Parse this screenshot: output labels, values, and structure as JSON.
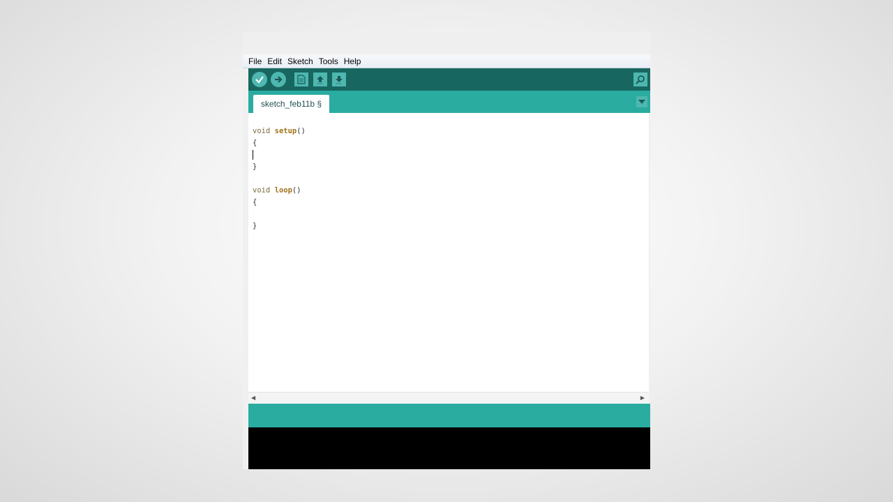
{
  "menu": {
    "items": [
      "File",
      "Edit",
      "Sketch",
      "Tools",
      "Help"
    ]
  },
  "toolbar": {
    "verify_icon": "checkmark-icon",
    "upload_icon": "arrow-right-icon",
    "new_icon": "document-icon",
    "open_icon": "arrow-up-icon",
    "save_icon": "arrow-down-icon",
    "serial_monitor_icon": "magnifier-icon"
  },
  "tabs": {
    "active_label": "sketch_feb11b §",
    "menu_icon": "triangle-down-icon"
  },
  "editor": {
    "setup_keyword": "void",
    "setup_name": "setup",
    "setup_parens": "()",
    "open_brace": "{",
    "close_brace": "}",
    "loop_keyword": "void",
    "loop_name": "loop",
    "loop_parens": "()"
  },
  "colors": {
    "toolbar": "#17665f",
    "tabbar": "#2aaca0",
    "button": "#4db7b0",
    "console": "#000000"
  }
}
